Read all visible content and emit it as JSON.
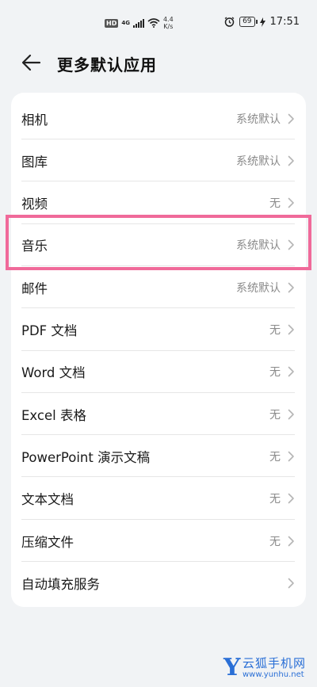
{
  "status_bar": {
    "hd": "HD",
    "net": "4G",
    "speed_value": "4.4",
    "speed_unit": "K/s",
    "battery": "69",
    "time": "17:51"
  },
  "header": {
    "title": "更多默认应用"
  },
  "rows": [
    {
      "label": "相机",
      "value": "系统默认"
    },
    {
      "label": "图库",
      "value": "系统默认"
    },
    {
      "label": "视频",
      "value": "无"
    },
    {
      "label": "音乐",
      "value": "系统默认"
    },
    {
      "label": "邮件",
      "value": "系统默认"
    },
    {
      "label": "PDF 文档",
      "value": "无"
    },
    {
      "label": "Word 文档",
      "value": "无"
    },
    {
      "label": "Excel 表格",
      "value": "无"
    },
    {
      "label": "PowerPoint 演示文稿",
      "value": "无"
    },
    {
      "label": "文本文档",
      "value": "无"
    },
    {
      "label": "压缩文件",
      "value": "无"
    },
    {
      "label": "自动填充服务",
      "value": ""
    }
  ],
  "watermark": {
    "letter": "Y",
    "name": "云狐手机网",
    "url": "www.yunhu.net"
  },
  "colors": {
    "highlight": "#f06a9a",
    "background": "#f1f3f5",
    "card": "#ffffff",
    "watermark": "#2a6fd6"
  }
}
